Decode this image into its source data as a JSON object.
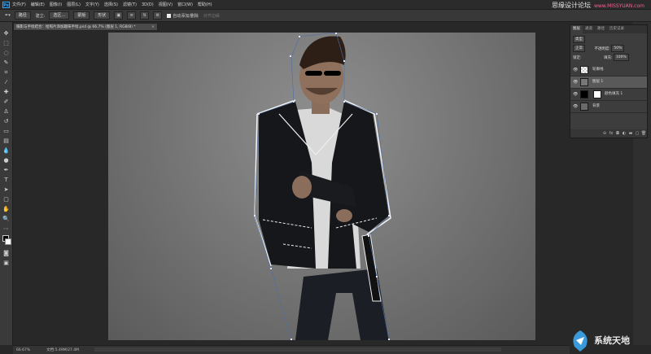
{
  "app": {
    "logo": "Ps"
  },
  "menu": [
    "文件(F)",
    "编辑(E)",
    "图像(I)",
    "图层(L)",
    "文字(Y)",
    "选择(S)",
    "滤镜(T)",
    "3D(D)",
    "视图(V)",
    "窗口(W)",
    "帮助(H)"
  ],
  "watermark_top": {
    "text": "思缘设计论坛",
    "url": "www.MISSYUAN.com"
  },
  "options": {
    "mode": "路径",
    "make": "建立:",
    "selection": "选区...",
    "mask": "蒙版",
    "shape": "形状",
    "auto_add": "自动添加/删除",
    "align_edges": "对齐边缘"
  },
  "document": {
    "tab": "摄影与手绘结合：给照片添加趣味手绘.psd @ 66.7% (图层 1, RGB/8) *",
    "close": "×"
  },
  "status": {
    "zoom": "66.67%",
    "doc": "文档:5.49M/27.4M"
  },
  "layers_panel": {
    "tabs": [
      "图层",
      "通道",
      "路径",
      "历史记录"
    ],
    "kind": "类型",
    "blend": "正常",
    "opacity_label": "不透明度:",
    "opacity": "50%",
    "lock_label": "锁定:",
    "fill_label": "填充:",
    "fill": "100%",
    "layers": [
      {
        "name": "轮廓线",
        "selected": false
      },
      {
        "name": "图层 1",
        "selected": true
      },
      {
        "name": "颜色填充 1",
        "selected": false
      },
      {
        "name": "背景",
        "selected": false
      }
    ]
  },
  "watermark_bottom": {
    "text": "系统天地"
  },
  "colors": {
    "accent": "#31a8ff",
    "panel": "#3d3d3d",
    "selected_layer": "#595959"
  }
}
